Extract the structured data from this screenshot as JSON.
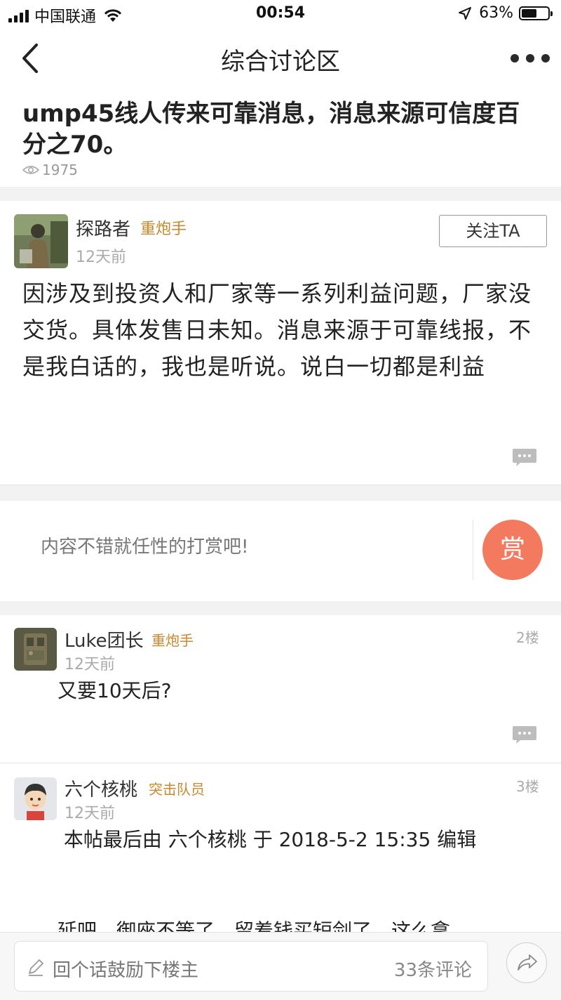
{
  "status_bar": {
    "carrier": "中国联通",
    "time": "00:54",
    "battery_percent": "63%",
    "battery_level": 0.63,
    "icons": [
      "signal-icon",
      "wifi-icon",
      "location-arrow-icon",
      "battery-icon"
    ]
  },
  "nav": {
    "title": "综合讨论区",
    "back_icon": "chevron-left-icon",
    "more_icon": "more-dots-icon"
  },
  "post": {
    "title": "ump45线人传来可靠消息，消息来源可信度百分之70。",
    "views": "1975",
    "author": {
      "name": "探路者",
      "badge": "重炮手",
      "time": "12天前"
    },
    "follow_label": "关注TA",
    "body": "因涉及到投资人和厂家等一系列利益问题，厂家没交货。具体发售日未知。消息来源于可靠线报，不是我白话的，我也是听说。说白一切都是利益"
  },
  "reward": {
    "prompt": "内容不错就任性的打赏吧!",
    "button_label": "赏"
  },
  "replies": [
    {
      "name": "Luke团长",
      "badge": "重炮手",
      "time": "12天前",
      "floor": "2楼",
      "body": "又要10天后?"
    },
    {
      "name": "六个核桃",
      "badge": "突击队员",
      "time": "12天前",
      "floor": "3楼",
      "body": " 本帖最后由 六个核桃 于 2018-5-2 15:35 编辑",
      "body_cut": "延吧，御座不等了，留着钱买短剑了，这么拿"
    }
  ],
  "bottom_bar": {
    "placeholder": "回个话鼓励下楼主",
    "comment_count": "33条评论",
    "share_icon": "share-arrow-icon"
  },
  "colors": {
    "badge": "#c8892e",
    "reward_button": "#f47a5f",
    "separator_bg": "#f2f2f2"
  }
}
